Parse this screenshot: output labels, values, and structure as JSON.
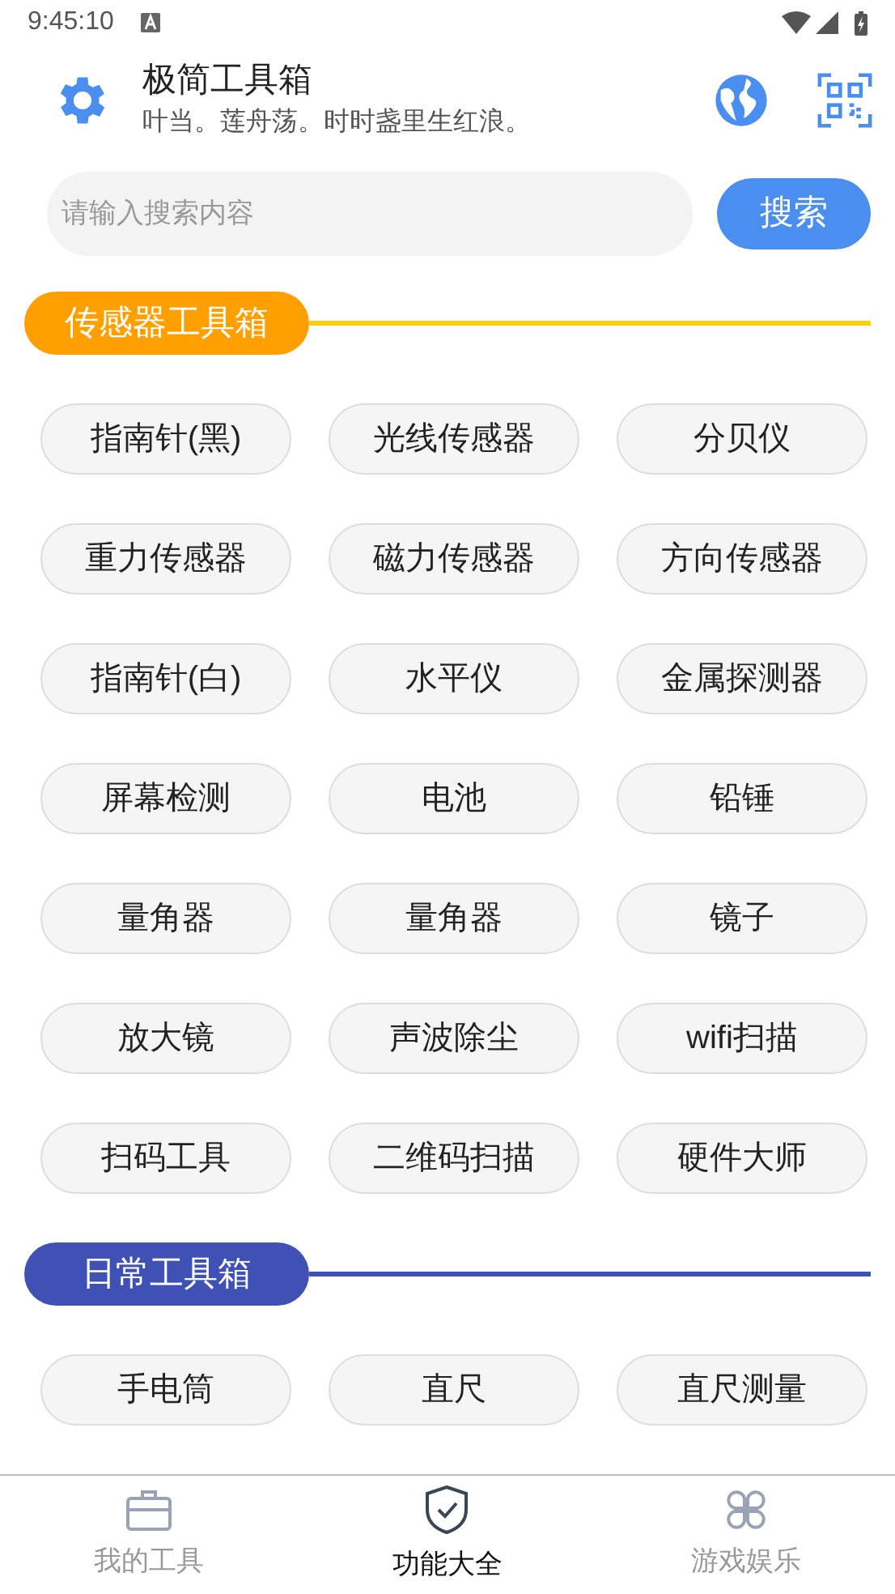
{
  "status_bar": {
    "time": "9:45:10"
  },
  "header": {
    "title": "极简工具箱",
    "subtitle": "叶当。莲舟荡。时时盏里生红浪。"
  },
  "search": {
    "placeholder": "请输入搜索内容",
    "button": "搜索"
  },
  "sections": [
    {
      "title": "传感器工具箱",
      "color": "#ffa000",
      "items": [
        "指南针(黑)",
        "光线传感器",
        "分贝仪",
        "重力传感器",
        "磁力传感器",
        "方向传感器",
        "指南针(白)",
        "水平仪",
        "金属探测器",
        "屏幕检测",
        "电池",
        "铅锤",
        "量角器",
        "量角器",
        "镜子",
        "放大镜",
        "声波除尘",
        "wifi扫描",
        "扫码工具",
        "二维码扫描",
        "硬件大师"
      ]
    },
    {
      "title": "日常工具箱",
      "color": "#3f51b5",
      "items": [
        "手电筒",
        "直尺",
        "直尺测量"
      ]
    }
  ],
  "bottom_nav": [
    {
      "label": "我的工具",
      "selected": false
    },
    {
      "label": "功能大全",
      "selected": true
    },
    {
      "label": "游戏娱乐",
      "selected": false
    }
  ]
}
